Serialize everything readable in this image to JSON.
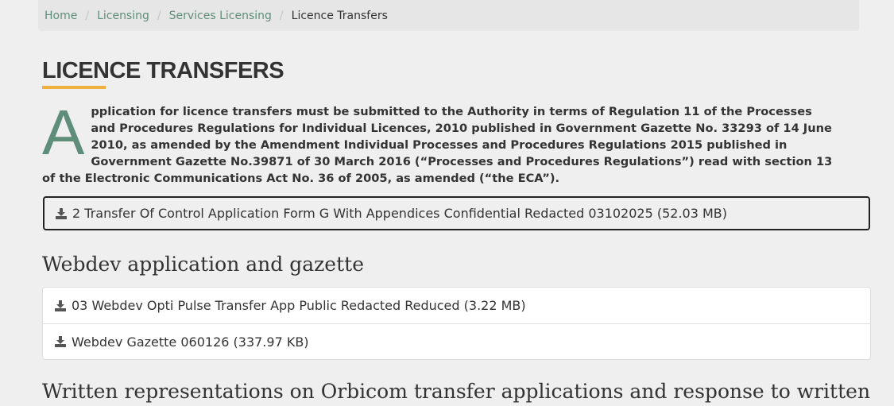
{
  "breadcrumb": {
    "items": [
      "Home",
      "Licensing",
      "Services Licensing"
    ],
    "current": "Licence Transfers"
  },
  "page": {
    "title": "LICENCE TRANSFERS",
    "intro_dropcap": "A",
    "intro_text": "pplication for licence transfers must be submitted to the Authority in terms of Regulation 11 of the Processes and Procedures Regulations for Individual Licences, 2010 published in Government Gazette No. 33293 of 14 June 2010, as amended by the Amendment Individual Processes and Procedures Regulations 2015 published in Government Gazette No.39871 of 30 March 2016 (“Processes and Procedures Regulations”) read with section 13 of the Electronic Communications Act No. 36 of 2005, as amended (“the ECA”)."
  },
  "downloads": {
    "main": "2 Transfer Of Control Application Form G With Appendices Confidential Redacted 03102025 (52.03 MB)"
  },
  "sections": [
    {
      "heading": "Webdev application and gazette",
      "files": [
        "03 Webdev Opti Pulse Transfer App Public Redacted Reduced (3.22 MB)",
        "Webdev Gazette 060126 (337.97 KB)"
      ]
    },
    {
      "heading": "Written representations on Orbicom transfer applications and response to written"
    }
  ],
  "icons": {
    "download": "download-icon"
  },
  "colors": {
    "accent": "#5e8e7a",
    "underline": "#f0b03e"
  }
}
